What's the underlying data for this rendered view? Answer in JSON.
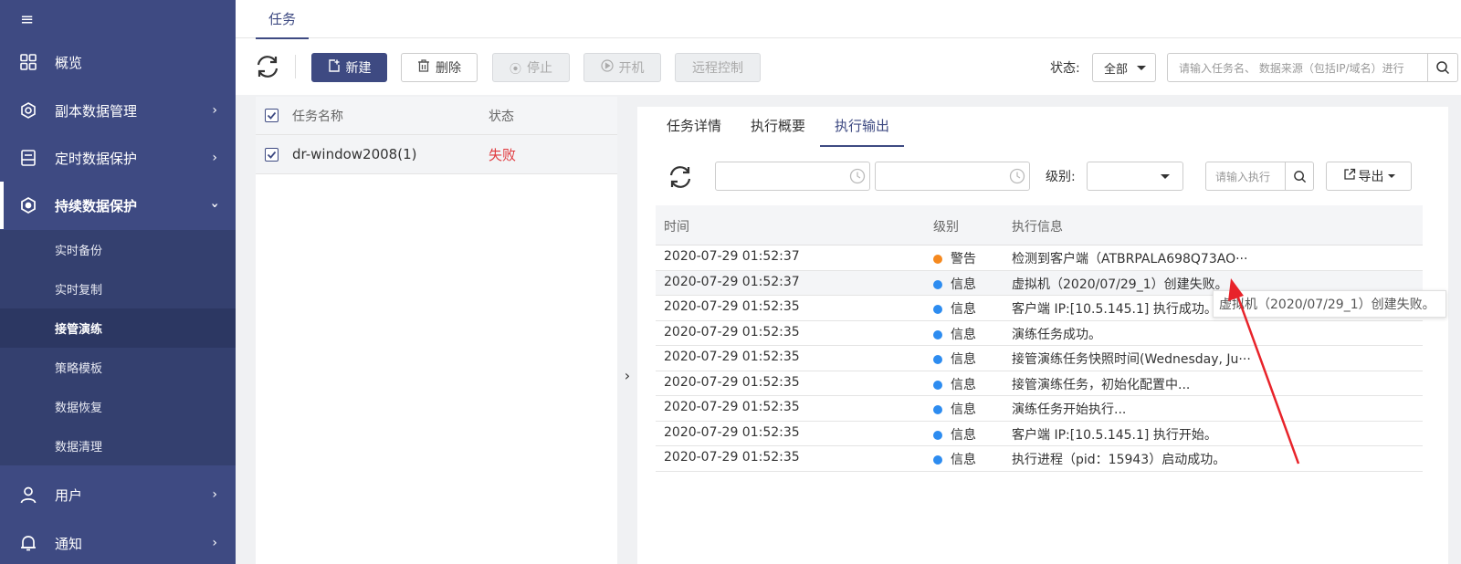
{
  "sidebar": {
    "items": [
      {
        "label": "概览",
        "icon": "grid-icon"
      },
      {
        "label": "副本数据管理",
        "icon": "copy-data-icon"
      },
      {
        "label": "定时数据保护",
        "icon": "scheduled-protect-icon"
      },
      {
        "label": "持续数据保护",
        "icon": "continuous-protect-icon"
      },
      {
        "label": "用户",
        "icon": "user-icon"
      },
      {
        "label": "通知",
        "icon": "bell-icon"
      }
    ],
    "subitems": [
      "实时备份",
      "实时复制",
      "接管演练",
      "策略模板",
      "数据恢复",
      "数据清理"
    ],
    "selected_subitem": "接管演练"
  },
  "top_tab": "任务",
  "toolbar": {
    "new_label": "新建",
    "delete_label": "删除",
    "stop_label": "停止",
    "start_label": "开机",
    "remote_label": "远程控制",
    "status_label": "状态:",
    "status_value": "全部",
    "search_placeholder": "请输入任务名、 数据来源（包括IP/域名）进行"
  },
  "task_table": {
    "headers": {
      "name": "任务名称",
      "status": "状态"
    },
    "rows": [
      {
        "name": "dr-window2008(1)",
        "status": "失败"
      }
    ]
  },
  "detail": {
    "tabs": [
      "任务详情",
      "执行概要",
      "执行输出"
    ],
    "active_tab": "执行输出",
    "level_label": "级别:",
    "exec_placeholder": "请输入执行",
    "export_label": "导出",
    "log_headers": {
      "time": "时间",
      "level": "级别",
      "message": "执行信息"
    },
    "logs": [
      {
        "time": "2020-07-29 01:52:37",
        "level": "警告",
        "color": "#f5891f",
        "message": "检测到客户端（ATBRPALA698Q73AO···"
      },
      {
        "time": "2020-07-29 01:52:37",
        "level": "信息",
        "color": "#2d8cf0",
        "message": "虚拟机（2020/07/29_1）创建失败。"
      },
      {
        "time": "2020-07-29 01:52:35",
        "level": "信息",
        "color": "#2d8cf0",
        "message": "客户端 IP:[10.5.145.1] 执行成功。"
      },
      {
        "time": "2020-07-29 01:52:35",
        "level": "信息",
        "color": "#2d8cf0",
        "message": "演练任务成功。"
      },
      {
        "time": "2020-07-29 01:52:35",
        "level": "信息",
        "color": "#2d8cf0",
        "message": "接管演练任务快照时间(Wednesday, Ju···"
      },
      {
        "time": "2020-07-29 01:52:35",
        "level": "信息",
        "color": "#2d8cf0",
        "message": "接管演练任务，初始化配置中..."
      },
      {
        "time": "2020-07-29 01:52:35",
        "level": "信息",
        "color": "#2d8cf0",
        "message": "演练任务开始执行..."
      },
      {
        "time": "2020-07-29 01:52:35",
        "level": "信息",
        "color": "#2d8cf0",
        "message": "客户端 IP:[10.5.145.1] 执行开始。"
      },
      {
        "time": "2020-07-29 01:52:35",
        "level": "信息",
        "color": "#2d8cf0",
        "message": "执行进程（pid：15943）启动成功。"
      }
    ],
    "tooltip": "虚拟机（2020/07/29_1）创建失败。"
  },
  "colors": {
    "sidebar": "#3e4a82",
    "fail": "#e0393e",
    "warn": "#f5891f",
    "info": "#2d8cf0"
  }
}
